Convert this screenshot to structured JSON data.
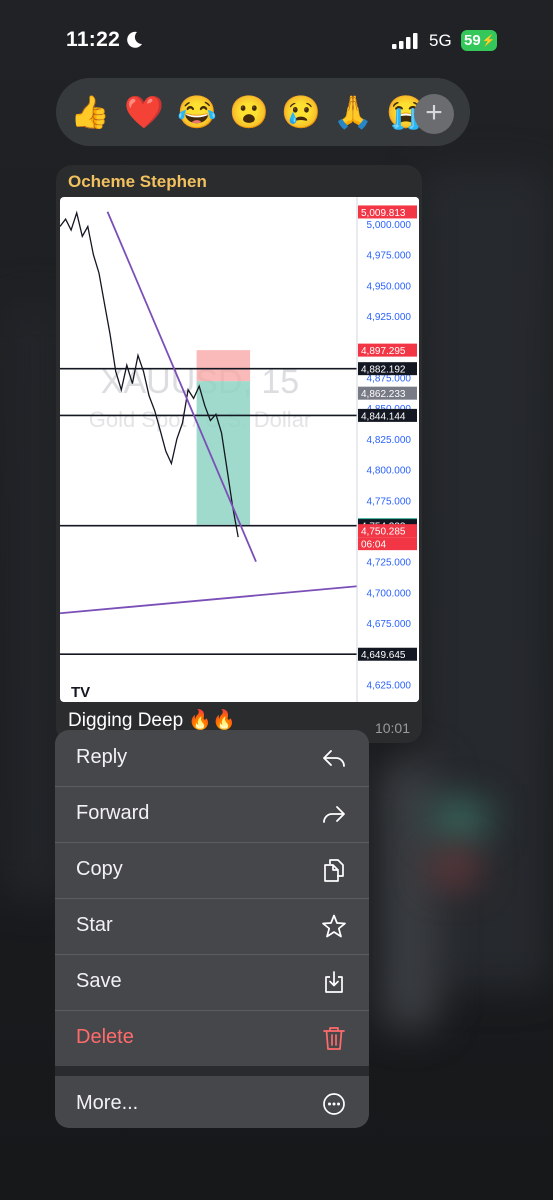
{
  "status_bar": {
    "time": "11:22",
    "network": "5G",
    "battery": "59"
  },
  "reactions": {
    "emojis": [
      "👍",
      "❤️",
      "😂",
      "😮",
      "😢",
      "🙏",
      "😭"
    ],
    "add_icon": "plus-icon"
  },
  "message": {
    "sender": "Ocheme Stephen",
    "caption": "Digging Deep 🔥🔥",
    "time": "10:01",
    "chart_image": {
      "watermark_symbol": "XAUUSD, 15",
      "watermark_name": "Gold Spot / U.S. Dollar",
      "logo": "TV"
    }
  },
  "chart_data": {
    "type": "line",
    "title": "XAUUSD, 15",
    "subtitle": "Gold Spot / U.S. Dollar",
    "xlabel": "",
    "ylabel": "",
    "ylim": [
      4615,
      5020
    ],
    "y_ticks": [
      "5,000.000",
      "4,975.000",
      "4,950.000",
      "4,925.000",
      "4,900.000",
      "4,875.000",
      "4,850.000",
      "4,825.000",
      "4,800.000",
      "4,775.000",
      "4,750.000",
      "4,725.000",
      "4,700.000",
      "4,675.000",
      "4,650.000",
      "4,625.000"
    ],
    "price_tags": [
      {
        "label": "5,009.813",
        "value": 5009.813,
        "color": "#f23645"
      },
      {
        "label": "4,897.295",
        "value": 4897.295,
        "color": "#f23645"
      },
      {
        "label": "4,882.192",
        "value": 4882.192,
        "color": "#131722"
      },
      {
        "label": "4,862.233",
        "value": 4862.233,
        "color": "#787b86"
      },
      {
        "label": "4,844.144",
        "value": 4844.144,
        "color": "#131722"
      },
      {
        "label": "4,755.056",
        "value": 4755.056,
        "color": "#089981"
      },
      {
        "label": "4,754.333",
        "value": 4754.333,
        "color": "#131722"
      },
      {
        "label": "4,750.285",
        "value": 4750.285,
        "color": "#f23645"
      },
      {
        "label": "4,649.645",
        "value": 4649.645,
        "color": "#131722"
      }
    ],
    "countdown": "06:04",
    "horizontal_levels": [
      4882.192,
      4844.144,
      4754.333,
      4649.645
    ],
    "price_series": [
      4998,
      5004,
      4995,
      5009,
      4990,
      4998,
      4975,
      4960,
      4935,
      4910,
      4880,
      4865,
      4885,
      4870,
      4893,
      4880,
      4860,
      4848,
      4832,
      4815,
      4805,
      4825,
      4838,
      4865,
      4858,
      4868,
      4852,
      4840,
      4845,
      4830,
      4800,
      4770,
      4745
    ],
    "trendlines": [
      {
        "from": [
          0.16,
          5010
        ],
        "to": [
          0.66,
          4725
        ],
        "color": "#7b4fb8"
      },
      {
        "from": [
          0.0,
          4683
        ],
        "to": [
          1.0,
          4705
        ],
        "color": "#7b4fb8"
      }
    ],
    "position": {
      "entry": 4872,
      "stop": 4897.295,
      "target": 4755.056,
      "x_start": 0.46,
      "x_end": 0.64
    },
    "grid": false,
    "legend": "none"
  },
  "menu": {
    "items": [
      {
        "label": "Reply",
        "icon": "reply-icon"
      },
      {
        "label": "Forward",
        "icon": "forward-icon"
      },
      {
        "label": "Copy",
        "icon": "copy-icon"
      },
      {
        "label": "Star",
        "icon": "star-icon"
      },
      {
        "label": "Save",
        "icon": "save-icon"
      },
      {
        "label": "Delete",
        "icon": "trash-icon",
        "color": "#ff6b6b"
      }
    ],
    "more": {
      "label": "More...",
      "icon": "more-icon"
    }
  }
}
